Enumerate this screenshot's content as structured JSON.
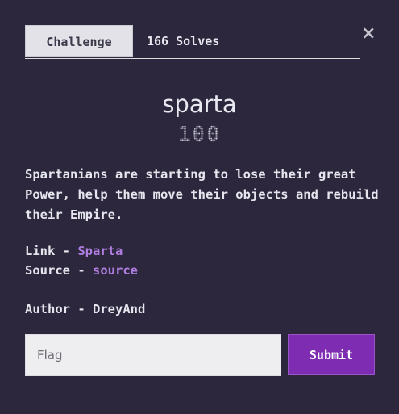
{
  "tabs": {
    "challenge_label": "Challenge",
    "solves_label": "166 Solves"
  },
  "close_icon": "×",
  "challenge": {
    "name": "sparta",
    "points": "100",
    "description": "Spartanians are starting to lose their great Power, help them move their objects and rebuild their Empire.",
    "link_label": "Link - ",
    "link_text": "Sparta",
    "source_label": "Source - ",
    "source_text": "source",
    "author_label": "Author - ",
    "author_name": "DreyAnd"
  },
  "form": {
    "flag_placeholder": "Flag",
    "submit_label": "Submit"
  },
  "colors": {
    "background": "#2c273d",
    "accent": "#7e2db3",
    "link": "#b07ee0"
  }
}
